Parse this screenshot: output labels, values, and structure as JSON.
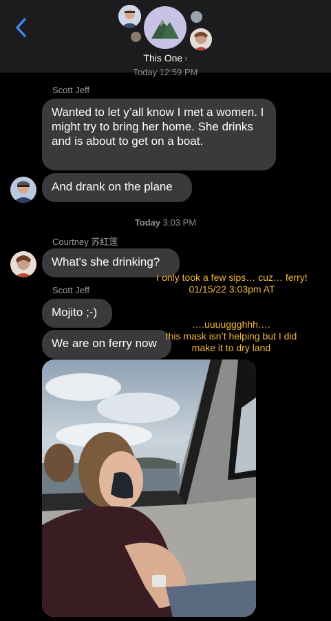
{
  "header": {
    "back_icon": "chevron-left-icon",
    "group_name": "This One",
    "group_avatar_icon": "mountain-icon",
    "accent_color": "#3e8df7"
  },
  "conversation": {
    "timestamp_1": "Today 12:59 PM",
    "sender_1": "Scott Jeff",
    "msg_1": "Wanted to let y’all know I met a women.  I might try to bring her home. She drinks and is about to get on a boat.",
    "msg_2": "And drank on the plane",
    "timestamp_2_day": "Today",
    "timestamp_2_time": "3:03 PM",
    "sender_2": "Courtney 苏红莲",
    "msg_3": "What's she drinking?",
    "sender_3": "Scott Jeff",
    "msg_4": "Mojito ;-)",
    "msg_5": "We are on ferry now"
  },
  "annotations": {
    "note_1_line1": "I only took a few sips… cuz… ferry!",
    "note_1_line2": "01/15/22 3:03pm AT",
    "note_2_line1": "….uuuuggghhh….",
    "note_2_line2": "this mask isn’t helping but I did",
    "note_2_line3": "make it to dry land",
    "note_color": "#f5b73b"
  }
}
